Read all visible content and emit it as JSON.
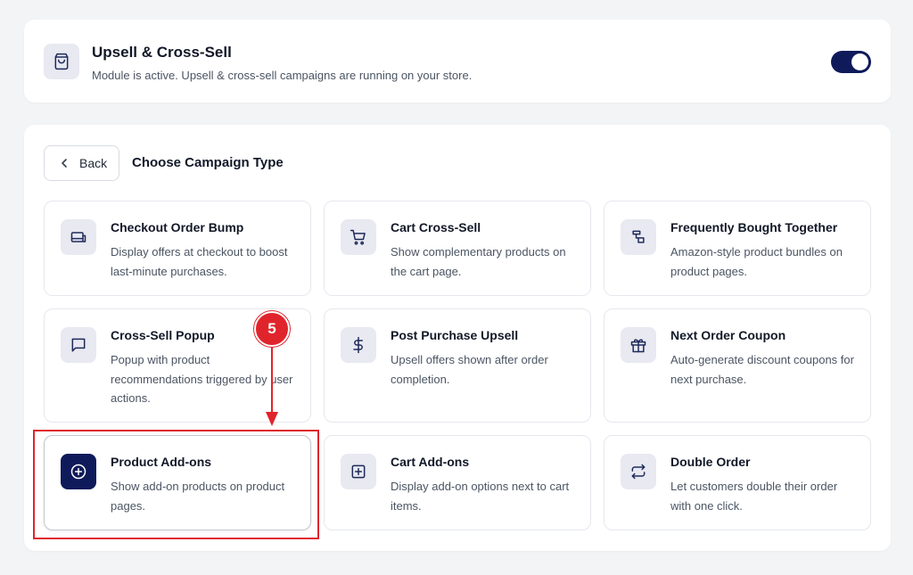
{
  "module": {
    "title": "Upsell & Cross-Sell",
    "description": "Module is active. Upsell & cross-sell campaigns are running on your store.",
    "active": true,
    "icon": "shopping-bag-icon"
  },
  "header": {
    "back_label": "Back",
    "title": "Choose Campaign Type"
  },
  "campaigns": [
    {
      "title": "Checkout Order Bump",
      "desc": "Display offers at checkout to boost last-minute purchases.",
      "icon": "card-icon"
    },
    {
      "title": "Cart Cross-Sell",
      "desc": "Show complementary products on the cart page.",
      "icon": "cart-icon"
    },
    {
      "title": "Frequently Bought Together",
      "desc": "Amazon-style product bundles on product pages.",
      "icon": "bundle-icon"
    },
    {
      "title": "Cross-Sell Popup",
      "desc": "Popup with product recommendations triggered by user actions.",
      "icon": "message-icon"
    },
    {
      "title": "Post Purchase Upsell",
      "desc": "Upsell offers shown after order completion.",
      "icon": "dollar-icon"
    },
    {
      "title": "Next Order Coupon",
      "desc": "Auto-generate discount coupons for next purchase.",
      "icon": "gift-icon"
    },
    {
      "title": "Product Add-ons",
      "desc": "Show add-on products on product pages.",
      "icon": "plus-circle-icon",
      "selected": true
    },
    {
      "title": "Cart Add-ons",
      "desc": "Display add-on options next to cart items.",
      "icon": "plus-square-icon"
    },
    {
      "title": "Double Order",
      "desc": "Let customers double their order with one click.",
      "icon": "repeat-icon"
    }
  ],
  "annotation": {
    "step": "5",
    "color": "#e0242c"
  },
  "colors": {
    "accent": "#0f1a5a",
    "icon_bg": "#e8e9f1",
    "page_bg": "#f3f4f6"
  }
}
